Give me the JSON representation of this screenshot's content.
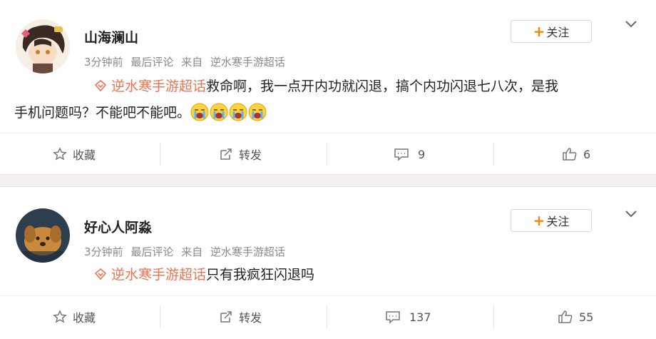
{
  "posts": [
    {
      "username": "山海澜山",
      "meta": [
        "3分钟前",
        "最后评论",
        "来自",
        "逆水寒手游超话"
      ],
      "follow_label": "关注",
      "topic": "逆水寒手游超话",
      "text_line1": "救命啊，我一点开内功就闪退，搞个内功闪退七八次，是我",
      "text_line2": "手机问题吗？不能吧不能吧。",
      "emoji": [
        "crying-face-emoji",
        "crying-face-emoji",
        "crying-face-emoji",
        "crying-face-emoji"
      ],
      "actions": {
        "favorite": "收藏",
        "repost": "转发",
        "comments": "9",
        "likes": "6"
      }
    },
    {
      "username": "好心人阿淼",
      "meta": [
        "3分钟前",
        "最后评论",
        "来自",
        "逆水寒手游超话"
      ],
      "follow_label": "关注",
      "topic": "逆水寒手游超话",
      "text_line1": "只有我疯狂闪退吗",
      "actions": {
        "favorite": "收藏",
        "repost": "转发",
        "comments": "137",
        "likes": "55"
      }
    }
  ],
  "colors": {
    "accent": "#ff8200",
    "topic": "#eb7350",
    "meta": "#8a8a8a"
  }
}
